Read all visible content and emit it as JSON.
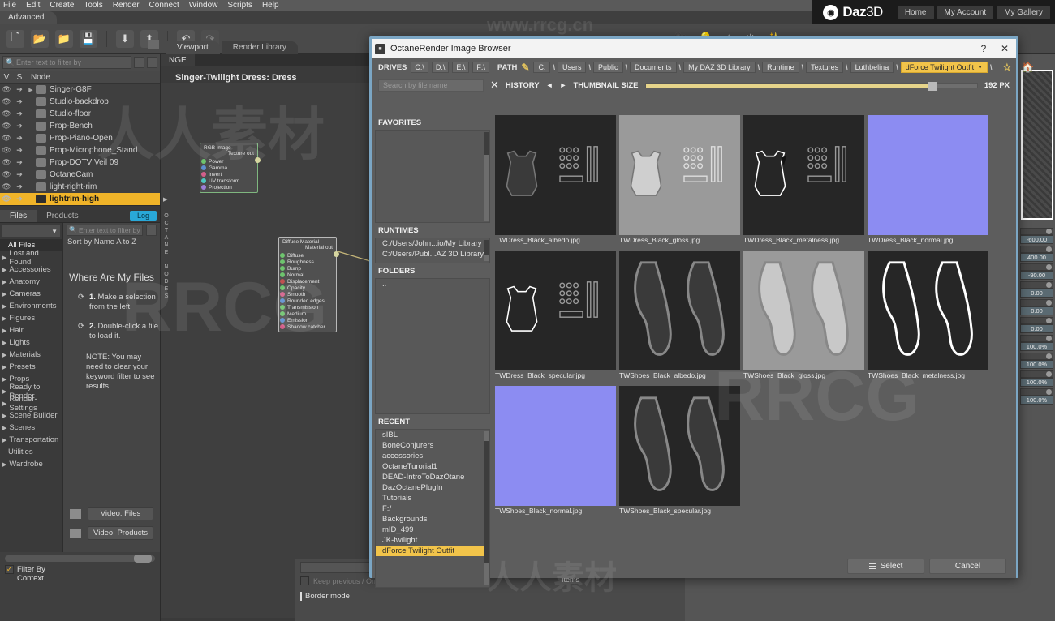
{
  "app": {
    "menu": [
      "File",
      "Edit",
      "Create",
      "Tools",
      "Render",
      "Connect",
      "Window",
      "Scripts",
      "Help"
    ],
    "mode_tab": "Advanced",
    "daz": {
      "brand_daz": "Daz",
      "brand_3d": "3D",
      "links": [
        "Home",
        "My Account",
        "My Gallery"
      ]
    },
    "viewport_tabs": [
      "Viewport",
      "Render Library"
    ],
    "toolbar_icons": [
      "new-file-icon",
      "open-file-icon",
      "open-recent-icon",
      "save-icon",
      "import-icon",
      "export-icon",
      "undo-icon",
      "redo-icon",
      "camera-icon",
      "spot-light-icon",
      "point-light-icon",
      "distant-light-icon",
      "magic-wand-icon"
    ]
  },
  "scene": {
    "search_placeholder": "Enter text to filter by",
    "columns": [
      "V",
      "S",
      "Node"
    ],
    "nodes": [
      {
        "label": "Singer-G8F",
        "selected": false,
        "expandable": true
      },
      {
        "label": "Studio-backdrop",
        "selected": false,
        "expandable": false
      },
      {
        "label": "Studio-floor",
        "selected": false,
        "expandable": false
      },
      {
        "label": "Prop-Bench",
        "selected": false,
        "expandable": false
      },
      {
        "label": "Prop-Piano-Open",
        "selected": false,
        "expandable": false
      },
      {
        "label": "Prop-Microphone_Stand",
        "selected": false,
        "expandable": false
      },
      {
        "label": "Prop-DOTV Veil 09",
        "selected": false,
        "expandable": false
      },
      {
        "label": "OctaneCam",
        "selected": false,
        "expandable": false
      },
      {
        "label": "light-right-rim",
        "selected": false,
        "expandable": false
      },
      {
        "label": "lightrim-high",
        "selected": true,
        "expandable": false
      }
    ]
  },
  "files_panel": {
    "tabs": [
      "Files",
      "Products"
    ],
    "log_label": "Log",
    "filter_placeholder": "Enter text to filter by",
    "sort_label": "Sort by Name  A to Z",
    "categories": [
      {
        "label": "All Files",
        "active": true,
        "arrow": false
      },
      {
        "label": "Lost and Found",
        "active": false,
        "arrow": true
      },
      {
        "label": "Accessories",
        "active": false,
        "arrow": true
      },
      {
        "label": "Anatomy",
        "active": false,
        "arrow": true
      },
      {
        "label": "Cameras",
        "active": false,
        "arrow": true
      },
      {
        "label": "Environments",
        "active": false,
        "arrow": true
      },
      {
        "label": "Figures",
        "active": false,
        "arrow": true
      },
      {
        "label": "Hair",
        "active": false,
        "arrow": true
      },
      {
        "label": "Lights",
        "active": false,
        "arrow": true
      },
      {
        "label": "Materials",
        "active": false,
        "arrow": true
      },
      {
        "label": "Presets",
        "active": false,
        "arrow": true
      },
      {
        "label": "Props",
        "active": false,
        "arrow": true
      },
      {
        "label": "Ready to Render",
        "active": false,
        "arrow": true
      },
      {
        "label": "Render-Settings",
        "active": false,
        "arrow": true
      },
      {
        "label": "Scene Builder",
        "active": false,
        "arrow": true
      },
      {
        "label": "Scenes",
        "active": false,
        "arrow": true
      },
      {
        "label": "Transportation",
        "active": false,
        "arrow": true
      },
      {
        "label": "Utilities",
        "active": false,
        "arrow": false
      },
      {
        "label": "Wardrobe",
        "active": false,
        "arrow": true
      }
    ],
    "headline": "Where Are My Files",
    "step1_num": "1.",
    "step1_text": "Make a selection from the left.",
    "step2_num": "2.",
    "step2_text": "Double-click a file to load it.",
    "note": "NOTE: You may need to clear your keyword filter to see results.",
    "video_files": "Video: Files",
    "video_products": "Video: Products",
    "filter_by_context": "Filter By Context"
  },
  "node_editor": {
    "tab": "NGE",
    "title": "Singer-Twilight Dress: Dress",
    "vertical_label": "OCTANE NODES",
    "nodes": [
      {
        "title": "RGB image",
        "output": "Texture out",
        "ports": [
          {
            "label": "Power",
            "color": "#6ec46e"
          },
          {
            "label": "Gamma",
            "color": "#5d8fd0"
          },
          {
            "label": "Invert",
            "color": "#d35f8a"
          },
          {
            "label": "UV transform",
            "color": "#4dc8c0"
          },
          {
            "label": "Projection",
            "color": "#9d7fd8"
          }
        ]
      },
      {
        "title": "Diffuse Material",
        "output": "Material out",
        "ports": [
          {
            "label": "Diffuse",
            "color": "#6ec46e"
          },
          {
            "label": "Roughness",
            "color": "#6ec46e"
          },
          {
            "label": "Bump",
            "color": "#6ec46e"
          },
          {
            "label": "Normal",
            "color": "#6ec46e"
          },
          {
            "label": "Displacement",
            "color": "#c05050"
          },
          {
            "label": "Opacity",
            "color": "#6ec46e"
          },
          {
            "label": "Smooth",
            "color": "#d35f8a"
          },
          {
            "label": "Rounded edges",
            "color": "#5d8fd0"
          },
          {
            "label": "Transmission",
            "color": "#6ec46e"
          },
          {
            "label": "Medium",
            "color": "#6ec46e"
          },
          {
            "label": "Emission",
            "color": "#5d8fd0"
          },
          {
            "label": "Shadow catcher",
            "color": "#d35f8a"
          }
        ]
      }
    ]
  },
  "properties": {
    "values": [
      "-600.00",
      "400.00",
      "-90.00",
      "0.00",
      "0.00",
      "0.00",
      "100.0%",
      "100.0%",
      "100.0%",
      "100.0%"
    ]
  },
  "bottom": {
    "border_mode": "Border mode",
    "items_label": "Items",
    "checkbox_text": "Keep previous / On line map wire loaded"
  },
  "dialog": {
    "title": "OctaneRender Image Browser",
    "help_glyph": "?",
    "close_glyph": "✕",
    "drives_label": "DRIVES",
    "drives": [
      "C:\\",
      "D:\\",
      "E:\\",
      "F:\\"
    ],
    "path_label": "PATH",
    "pencil_icon": "pencil-icon",
    "path_crumbs": [
      "C:",
      "Users",
      "Public",
      "Documents",
      "My DAZ 3D Library",
      "Runtime",
      "Textures",
      "Luthbelina"
    ],
    "path_current": "dForce Twilight Outfit",
    "star_icon": "star-icon",
    "home_icon": "home-icon",
    "search_placeholder": "Search by file name",
    "clear_glyph": "✕",
    "history_label": "HISTORY",
    "history_back": "◄",
    "history_fwd": "►",
    "thumbnail_size_label": "THUMBNAIL SIZE",
    "thumbnail_px": "192 PX",
    "favorites_label": "FAVORITES",
    "favorites": [],
    "runtimes_label": "RUNTIMES",
    "runtimes": [
      "C:/Users/John...io/My Library",
      "C:/Users/Publ...AZ 3D Library"
    ],
    "folders_label": "FOLDERS",
    "folders": [
      ".."
    ],
    "recent_label": "RECENT",
    "recent": [
      "sIBL",
      "BoneConjurers",
      "accessories",
      "OctaneTurorial1",
      "DEAD-IntroToDazOtane",
      "DazOctanePlugIn",
      "Tutorials",
      "F:/",
      "Backgrounds",
      "mID_499",
      "JK-twilight"
    ],
    "recent_current": "dForce Twilight Outfit",
    "select_label": "Select",
    "cancel_label": "Cancel",
    "thumbnails": [
      {
        "name": "TWDress_Black_albedo.jpg",
        "kind": "dress-dark",
        "selected": false
      },
      {
        "name": "TWDress_Black_gloss.jpg",
        "kind": "dress-light",
        "selected": false
      },
      {
        "name": "TWDress_Black_metalness.jpg",
        "kind": "dress-outline",
        "selected": true
      },
      {
        "name": "TWDress_Black_normal.jpg",
        "kind": "normal-map",
        "selected": false
      },
      {
        "name": "TWDress_Black_specular.jpg",
        "kind": "dress-outline",
        "selected": false
      },
      {
        "name": "TWShoes_Black_albedo.jpg",
        "kind": "shoes-dark",
        "selected": false
      },
      {
        "name": "TWShoes_Black_gloss.jpg",
        "kind": "shoes-light",
        "selected": false
      },
      {
        "name": "TWShoes_Black_metalness.jpg",
        "kind": "shoes-outline",
        "selected": false
      },
      {
        "name": "TWShoes_Black_normal.jpg",
        "kind": "normal-map",
        "selected": false
      },
      {
        "name": "TWShoes_Black_specular.jpg",
        "kind": "shoes-dark",
        "selected": false
      }
    ]
  },
  "watermarks": {
    "url": "www.rrcg.cn",
    "big": "RRCG",
    "cn": "人人素材"
  },
  "colors": {
    "accent_yellow": "#f2c44a",
    "dialog_border": "#7ba6c4",
    "selection": "#f0b429"
  }
}
